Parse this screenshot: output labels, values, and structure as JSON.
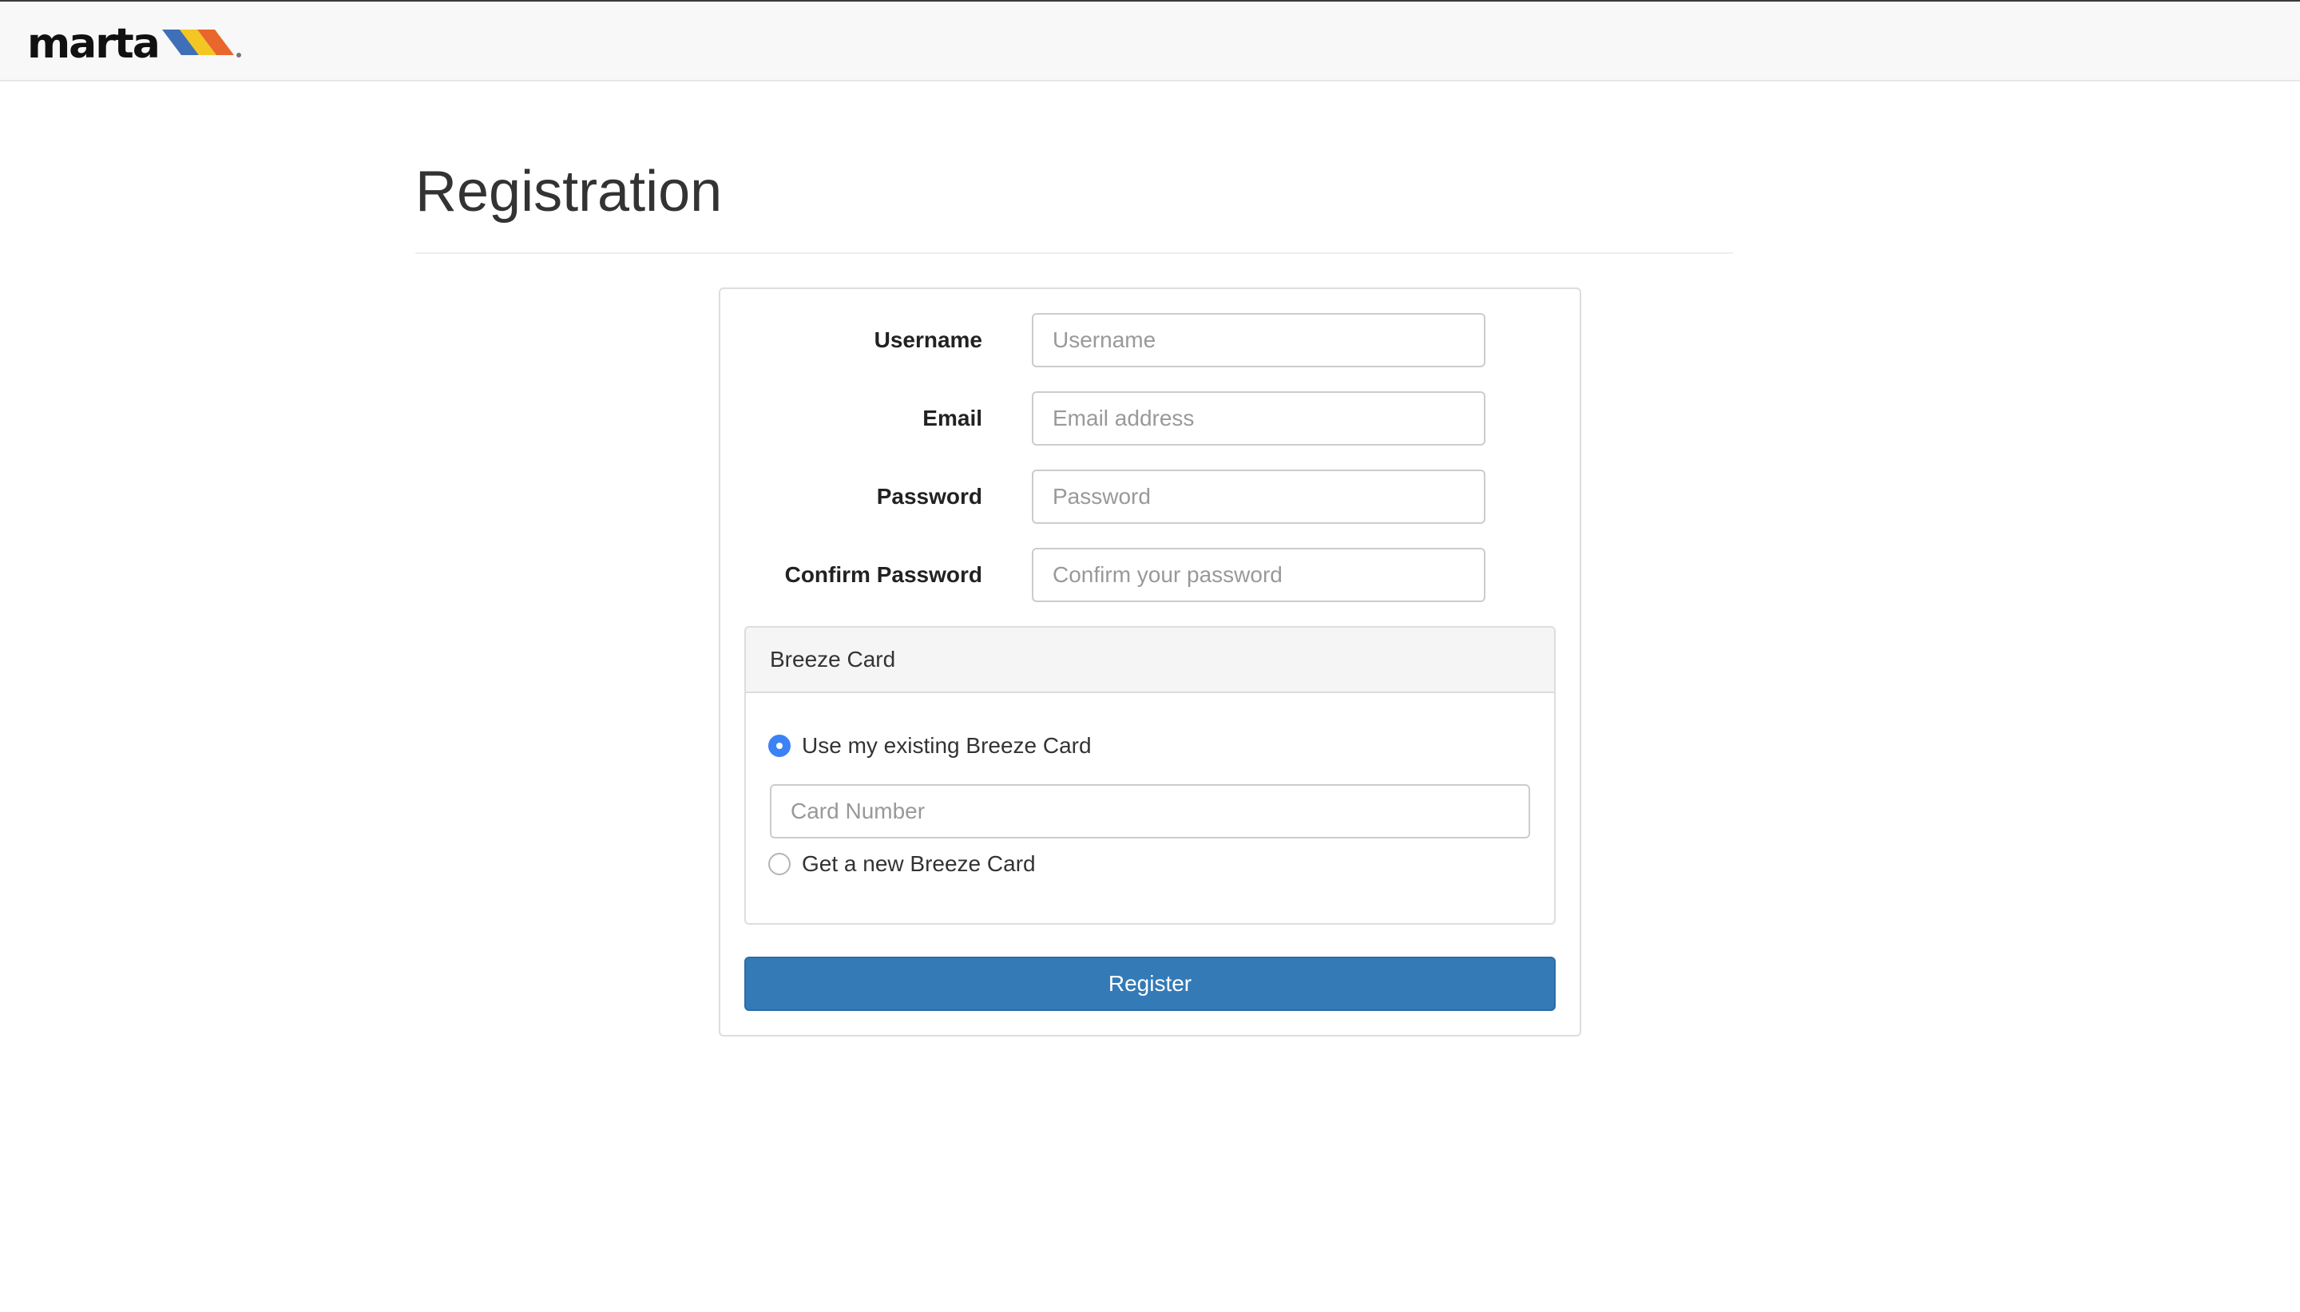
{
  "navbar": {
    "brand_text": "marta",
    "brand_colors": [
      "#3f6fb6",
      "#f3c623",
      "#e9662c"
    ]
  },
  "page": {
    "title": "Registration"
  },
  "form": {
    "username": {
      "label": "Username",
      "placeholder": "Username",
      "value": ""
    },
    "email": {
      "label": "Email",
      "placeholder": "Email address",
      "value": ""
    },
    "password": {
      "label": "Password",
      "placeholder": "Password",
      "value": ""
    },
    "confirm_password": {
      "label": "Confirm Password",
      "placeholder": "Confirm your password",
      "value": ""
    },
    "breeze_card": {
      "heading": "Breeze Card",
      "options": [
        {
          "label": "Use my existing Breeze Card",
          "checked": true
        },
        {
          "label": "Get a new Breeze Card",
          "checked": false
        }
      ],
      "card_number": {
        "placeholder": "Card Number",
        "value": ""
      }
    },
    "submit_label": "Register",
    "submit_color": "#337ab7"
  }
}
